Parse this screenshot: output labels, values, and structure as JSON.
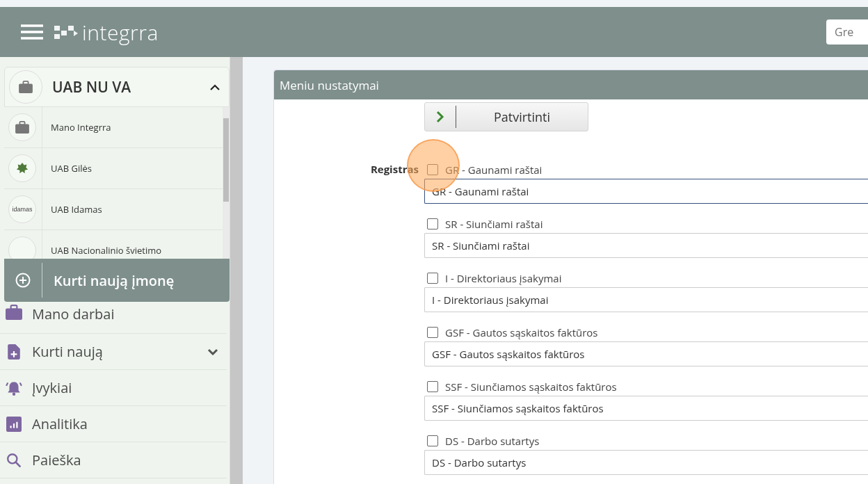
{
  "header": {
    "brand": "integrra",
    "search_placeholder": "Gre"
  },
  "sidebar": {
    "company": {
      "name": "UAB NU VA",
      "expanded": true
    },
    "companies": [
      {
        "name": "Mano Integrra",
        "kind": "briefcase"
      },
      {
        "name": "UAB Gilės",
        "kind": "leaf"
      },
      {
        "name": "UAB Idamas",
        "kind": "logo",
        "logo_text": "idamas"
      },
      {
        "name": "UAB Nacionalinio švietimo",
        "kind": "blank"
      }
    ],
    "create_button": "Kurti naują įmonę",
    "menu": [
      {
        "label": "Mano darbai",
        "kind": "briefcase",
        "expandable": false
      },
      {
        "label": "Kurti naują",
        "kind": "file-plus",
        "expandable": true
      },
      {
        "label": "Įvykiai",
        "kind": "bell",
        "expandable": false
      },
      {
        "label": "Analitika",
        "kind": "chart",
        "expandable": false
      },
      {
        "label": "Paieška",
        "kind": "search",
        "expandable": false
      }
    ]
  },
  "panel": {
    "title": "Meniu nustatymai",
    "confirm_button": "Patvirtinti",
    "field_label": "Registras",
    "registers": [
      {
        "label": "GR - Gaunami raštai",
        "checked": false,
        "value": "GR - Gaunami raštai",
        "focused": true
      },
      {
        "label": "SR - Siunčiami raštai",
        "checked": false,
        "value": "SR - Siunčiami raštai",
        "focused": false
      },
      {
        "label": "I - Direktoriaus įsakymai",
        "checked": false,
        "value": "I - Direktoriaus įsakymai",
        "focused": false
      },
      {
        "label": "GSF - Gautos sąskaitos faktūros",
        "checked": false,
        "value": "GSF - Gautos sąskaitos faktūros",
        "focused": false
      },
      {
        "label": "SSF - Siunčiamos sąskaitos faktūros",
        "checked": false,
        "value": "SSF - Siunčiamos sąskaitos faktūros",
        "focused": false
      },
      {
        "label": "DS - Darbo sutartys",
        "checked": false,
        "value": "DS - Darbo sutartys",
        "focused": false
      }
    ]
  }
}
